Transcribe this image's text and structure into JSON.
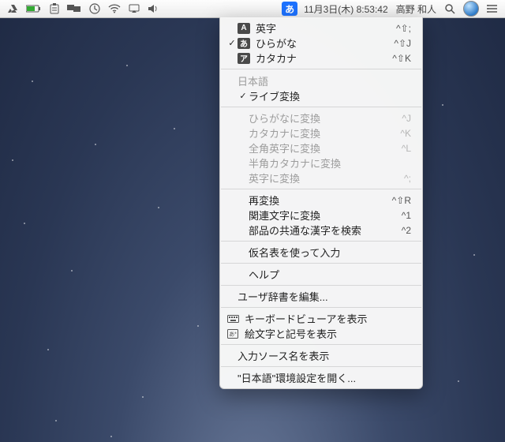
{
  "menubar": {
    "datetime": "11月3日(木)  8:53:42",
    "username": "高野 和人",
    "ime_badge": "あ"
  },
  "menu": {
    "modes": [
      {
        "badge": "A",
        "label": "英字",
        "shortcut": "^⇧;",
        "checked": false
      },
      {
        "badge": "あ",
        "label": "ひらがな",
        "shortcut": "^⇧J",
        "checked": true
      },
      {
        "badge": "ア",
        "label": "カタカナ",
        "shortcut": "^⇧K",
        "checked": false
      }
    ],
    "section_jp": "日本語",
    "live_conv": {
      "label": "ライブ変換",
      "checked": true
    },
    "convs": [
      {
        "label": "ひらがなに変換",
        "shortcut": "^J"
      },
      {
        "label": "カタカナに変換",
        "shortcut": "^K"
      },
      {
        "label": "全角英字に変換",
        "shortcut": "^L"
      },
      {
        "label": "半角カタカナに変換",
        "shortcut": ""
      },
      {
        "label": "英字に変換",
        "shortcut": "^;"
      }
    ],
    "reconv": [
      {
        "label": "再変換",
        "shortcut": "^⇧R"
      },
      {
        "label": "関連文字に変換",
        "shortcut": "^1"
      },
      {
        "label": "部品の共通な漢字を検索",
        "shortcut": "^2"
      }
    ],
    "kana_input": "仮名表を使って入力",
    "help": "ヘルプ",
    "edit_dict": "ユーザ辞書を編集...",
    "kb_viewer": "キーボードビューアを表示",
    "emoji": "絵文字と記号を表示",
    "show_source": "入力ソース名を表示",
    "open_prefs": "\"日本語\"環境設定を開く..."
  }
}
